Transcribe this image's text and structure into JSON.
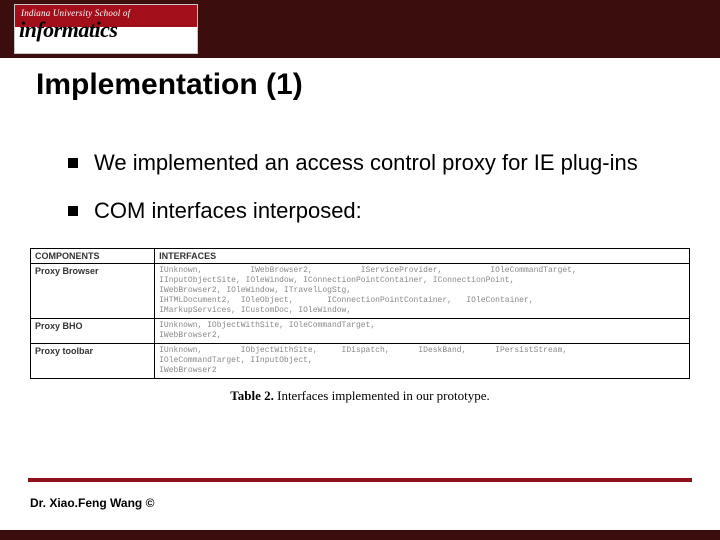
{
  "header": {
    "logo_tagline": "Indiana University School of",
    "logo_word": "informatics"
  },
  "title": "Implementation (1)",
  "bullets": [
    "We implemented an access control proxy for IE plug-ins",
    "COM interfaces interposed:"
  ],
  "table": {
    "headers": [
      "COMPONENTS",
      "INTERFACES"
    ],
    "rows": [
      {
        "component": "Proxy Browser",
        "interfaces": "IUnknown,          IWebBrowser2,          IServiceProvider,          IOleCommandTarget,\nIInputObjectSite, IOleWindow, IConnectionPointContainer, IConnectionPoint,\nIWebBrowser2, IOleWindow, ITravelLogStg,\nIHTMLDocument2,  IOleObject,       IConnectionPointContainer,   IOleContainer,\nIMarkupServices, ICustomDoc, IOleWindow,"
      },
      {
        "component": "Proxy BHO",
        "interfaces": "IUnknown, IObjectWithSite, IOleCommandTarget,\nIWebBrowser2,"
      },
      {
        "component": "Proxy toolbar",
        "interfaces": "IUnknown,        IObjectWithSite,     IDispatch,      IDeskBand,      IPersistStream,\nIOleCommandTarget, IInputObject,\nIWebBrowser2"
      }
    ],
    "caption_label": "Table 2.",
    "caption_text": "Interfaces implemented in our prototype."
  },
  "footer": "Dr. Xiao.Feng Wang  ©"
}
